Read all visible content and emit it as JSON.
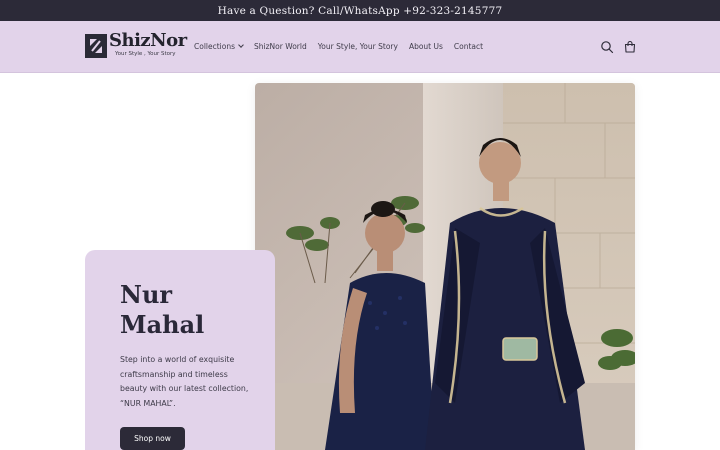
{
  "announcement": {
    "text": "Have a Question? Call/WhatsApp +92-323-2145777"
  },
  "brand": {
    "name": "ShizNor",
    "tagline": "Your Style , Your Story"
  },
  "nav": {
    "items": [
      {
        "label": "Collections",
        "has_dropdown": true
      },
      {
        "label": "ShizNor World"
      },
      {
        "label": "Your Style, Your Story"
      },
      {
        "label": "About Us"
      },
      {
        "label": "Contact"
      }
    ]
  },
  "header_icons": [
    "search-icon",
    "cart-icon"
  ],
  "hero": {
    "title": "Nur Mahal",
    "description": "Step into a world of exquisite craftsmanship and timeless beauty with our latest collection, “NUR MAHAL”.",
    "button_label": "Shop now"
  },
  "colors": {
    "announcement_bg": "#2c2a38",
    "header_bg": "#e2d3ea",
    "card_bg": "#e2d3ea",
    "button_bg": "#2c2a38"
  }
}
